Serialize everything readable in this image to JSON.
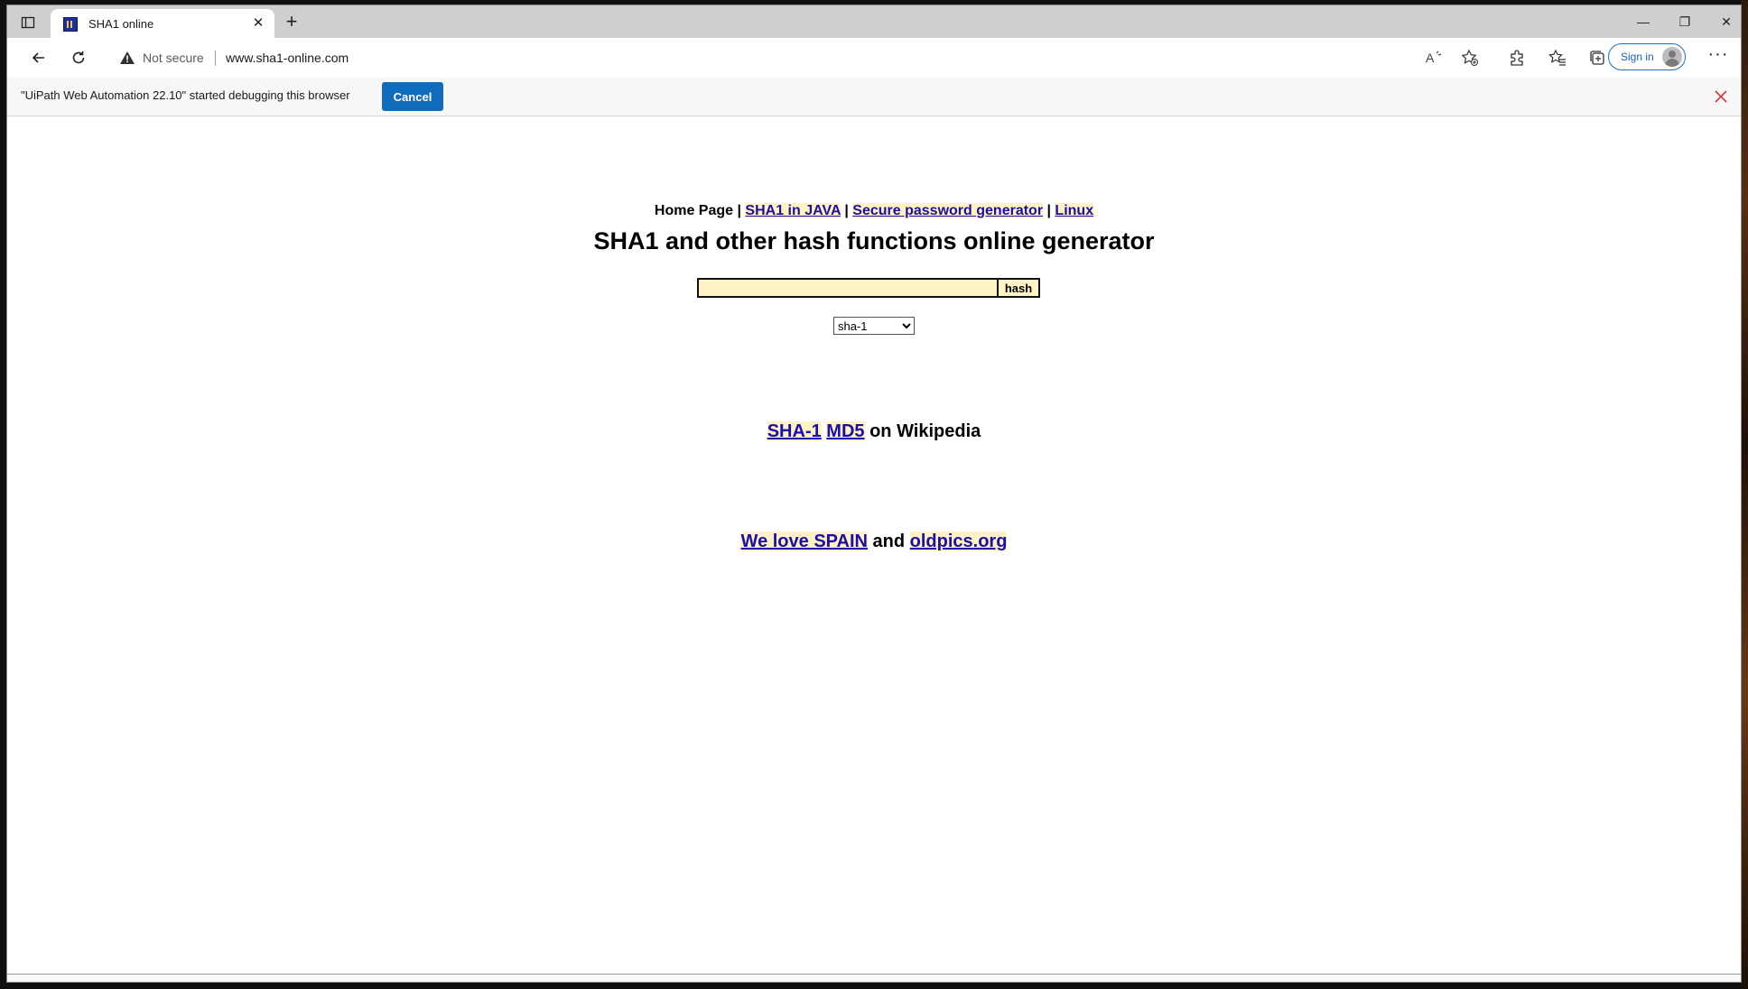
{
  "browser": {
    "tab": {
      "title": "SHA1 online",
      "close_glyph": "✕"
    },
    "new_tab_glyph": "+",
    "window_controls": {
      "minimize": "—",
      "restore": "❐",
      "close": "✕"
    },
    "address": {
      "security_label": "Not secure",
      "url": "www.sha1-online.com"
    },
    "signin_label": "Sign in",
    "more_glyph": "···",
    "toolbar_icons": [
      "read-aloud-icon",
      "add-favorite-icon",
      "extensions-icon",
      "favorites-icon",
      "collections-icon"
    ]
  },
  "infobar": {
    "message": "\"UiPath Web Automation 22.10\" started debugging this browser",
    "cancel_label": "Cancel"
  },
  "page": {
    "nav": {
      "home": "Home Page",
      "sep": " | ",
      "links": [
        "SHA1 in JAVA",
        "Secure password generator",
        "Linux"
      ]
    },
    "heading": "SHA1 and other hash functions online generator",
    "hash_input_value": "",
    "hash_button": "hash",
    "algorithm_selected": "sha-1",
    "wiki": {
      "link1": "SHA-1",
      "link2": "MD5",
      "suffix": " on Wikipedia"
    },
    "promo": {
      "link1": "We love SPAIN",
      "middle": " and ",
      "link2": "oldpics.org"
    }
  },
  "colors": {
    "link": "#1a0dab",
    "link_highlight": "#fff2c4",
    "cancel_button": "#0f6cbd",
    "tabstrip": "#cfcfcf"
  }
}
